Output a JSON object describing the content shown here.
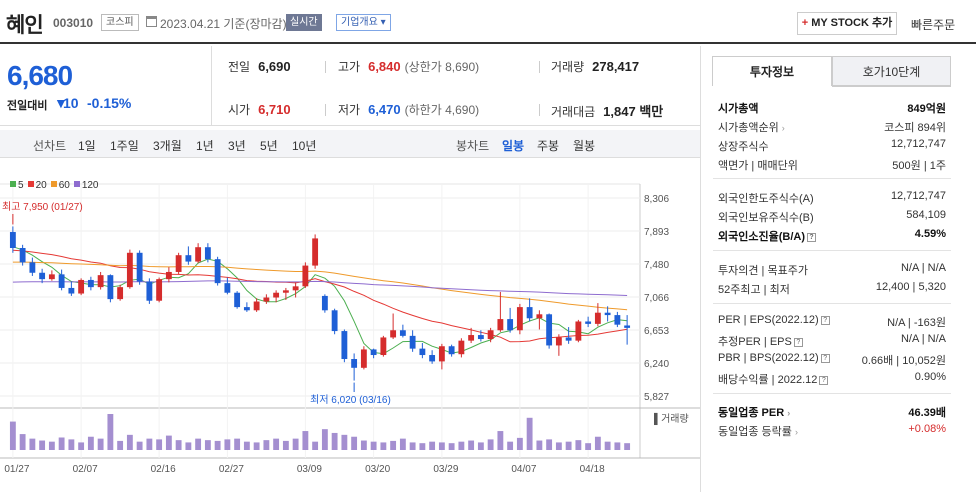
{
  "header": {
    "stock_name": "혜인",
    "stock_code": "003010",
    "market": "코스피",
    "date": "2023.04.21 기준(장마감)",
    "live_label": "실시간",
    "overview_label": "기업개요 ▾",
    "mystock_plus": "+",
    "mystock_label": "MY STOCK 추가",
    "quick_order": "빠른주문"
  },
  "quote": {
    "price": "6,680",
    "change_label": "전일대비",
    "change_arrow": "▼",
    "change_amount": "10",
    "change_pct": "-0.15%",
    "prev_close_label": "전일",
    "prev_close": "6,690",
    "high_label": "고가",
    "high": "6,840",
    "upper_limit": "(상한가 8,690)",
    "volume_label": "거래량",
    "volume": "278,417",
    "open_label": "시가",
    "open": "6,710",
    "low_label": "저가",
    "low": "6,470",
    "lower_limit": "(하한가 4,690)",
    "amount_label": "거래대금",
    "amount": "1,847 백만"
  },
  "tabs": {
    "line_chart": "선차트",
    "d1": "1일",
    "w1": "1주일",
    "m3": "3개월",
    "y1": "1년",
    "y3": "3년",
    "y5": "5년",
    "y10": "10년",
    "candle": "봉차트",
    "daily": "일봉",
    "weekly": "주봉",
    "monthly": "월봉"
  },
  "chart_data": {
    "type": "candlestick",
    "legend": [
      {
        "name": "5",
        "color": "#4caf50"
      },
      {
        "name": "20",
        "color": "#e53935"
      },
      {
        "name": "60",
        "color": "#ef9a2b"
      },
      {
        "name": "120",
        "color": "#8e6ccf"
      }
    ],
    "y_ticks": [
      "8,306",
      "7,893",
      "7,480",
      "7,066",
      "6,653",
      "6,240",
      "5,827"
    ],
    "ylim": [
      5827,
      8306
    ],
    "x_ticks": [
      "01/27",
      "02/07",
      "02/16",
      "02/27",
      "03/09",
      "03/20",
      "03/29",
      "04/07",
      "04/18"
    ],
    "max_label": "최고 7,950 (01/27)",
    "min_label": "최저 6,020 (03/16)",
    "volume_label": "거래량",
    "candles": [
      [
        7880,
        7950,
        7620,
        7680
      ],
      [
        7680,
        7720,
        7460,
        7500
      ],
      [
        7500,
        7560,
        7330,
        7370
      ],
      [
        7370,
        7420,
        7240,
        7290
      ],
      [
        7290,
        7400,
        7270,
        7350
      ],
      [
        7350,
        7410,
        7150,
        7180
      ],
      [
        7180,
        7260,
        7080,
        7110
      ],
      [
        7110,
        7300,
        7090,
        7280
      ],
      [
        7280,
        7320,
        7150,
        7190
      ],
      [
        7190,
        7380,
        7160,
        7340
      ],
      [
        7340,
        7350,
        7000,
        7040
      ],
      [
        7040,
        7220,
        7020,
        7190
      ],
      [
        7190,
        7660,
        7170,
        7620
      ],
      [
        7620,
        7650,
        7220,
        7260
      ],
      [
        7260,
        7300,
        6980,
        7020
      ],
      [
        7020,
        7310,
        7000,
        7290
      ],
      [
        7290,
        7440,
        7250,
        7380
      ],
      [
        7380,
        7620,
        7350,
        7590
      ],
      [
        7590,
        7700,
        7470,
        7510
      ],
      [
        7510,
        7740,
        7490,
        7690
      ],
      [
        7690,
        7740,
        7500,
        7540
      ],
      [
        7540,
        7570,
        7210,
        7240
      ],
      [
        7240,
        7310,
        7100,
        7120
      ],
      [
        7120,
        7140,
        6920,
        6940
      ],
      [
        6940,
        7000,
        6880,
        6900
      ],
      [
        6900,
        7050,
        6880,
        7010
      ],
      [
        7010,
        7100,
        6980,
        7060
      ],
      [
        7060,
        7150,
        7000,
        7120
      ],
      [
        7120,
        7180,
        7030,
        7150
      ],
      [
        7150,
        7250,
        7060,
        7200
      ],
      [
        7200,
        7500,
        7180,
        7460
      ],
      [
        7460,
        7850,
        7420,
        7800
      ],
      [
        7080,
        7100,
        6870,
        6900
      ],
      [
        6900,
        6920,
        6600,
        6640
      ],
      [
        6640,
        6660,
        6250,
        6290
      ],
      [
        6290,
        6360,
        6020,
        6180
      ],
      [
        6180,
        6450,
        6160,
        6410
      ],
      [
        6410,
        6420,
        6300,
        6340
      ],
      [
        6340,
        6580,
        6320,
        6560
      ],
      [
        6560,
        6860,
        6540,
        6650
      ],
      [
        6650,
        6720,
        6560,
        6580
      ],
      [
        6580,
        6650,
        6380,
        6420
      ],
      [
        6420,
        6490,
        6300,
        6340
      ],
      [
        6340,
        6400,
        6230,
        6260
      ],
      [
        6260,
        6480,
        6160,
        6450
      ],
      [
        6450,
        6470,
        6320,
        6350
      ],
      [
        6350,
        6550,
        6310,
        6520
      ],
      [
        6520,
        6680,
        6490,
        6590
      ],
      [
        6590,
        6650,
        6510,
        6540
      ],
      [
        6540,
        6680,
        6500,
        6650
      ],
      [
        6650,
        7130,
        6630,
        6790
      ],
      [
        6790,
        6930,
        6620,
        6650
      ],
      [
        6650,
        6980,
        6600,
        6940
      ],
      [
        6940,
        7050,
        6760,
        6800
      ],
      [
        6800,
        6900,
        6660,
        6850
      ],
      [
        6850,
        6860,
        6420,
        6460
      ],
      [
        6460,
        6600,
        6330,
        6560
      ],
      [
        6560,
        6690,
        6480,
        6520
      ],
      [
        6520,
        6780,
        6500,
        6760
      ],
      [
        6760,
        6820,
        6690,
        6730
      ],
      [
        6730,
        6990,
        6700,
        6870
      ],
      [
        6870,
        6950,
        6760,
        6840
      ],
      [
        6840,
        6880,
        6690,
        6720
      ],
      [
        6710,
        6840,
        6470,
        6680
      ]
    ],
    "volumes": [
      75,
      42,
      30,
      25,
      22,
      33,
      28,
      20,
      35,
      30,
      95,
      24,
      40,
      22,
      30,
      28,
      38,
      26,
      20,
      30,
      26,
      24,
      28,
      30,
      22,
      20,
      26,
      30,
      24,
      30,
      50,
      22,
      55,
      45,
      40,
      35,
      25,
      22,
      20,
      24,
      30,
      20,
      18,
      22,
      20,
      18,
      22,
      25,
      20,
      28,
      50,
      22,
      32,
      85,
      25,
      28,
      20,
      22,
      26,
      18,
      35,
      22,
      20,
      18
    ]
  },
  "info": {
    "tab_active": "투자정보",
    "tab_other": "호가10단계",
    "market_cap_label": "시가총액",
    "market_cap": "849억원",
    "market_cap_rank_label": "시가총액순위",
    "market_cap_rank": "코스피 894위",
    "shares_label": "상장주식수",
    "shares": "12,712,747",
    "par_label": "액면가",
    "trade_unit_label": "매매단위",
    "par_value": "500원",
    "trade_unit": "1주",
    "foreign_limit_label": "외국인한도주식수(A)",
    "foreign_limit": "12,712,747",
    "foreign_hold_label": "외국인보유주식수(B)",
    "foreign_hold": "584,109",
    "foreign_rate_label": "외국인소진율(B/A)",
    "foreign_rate": "4.59%",
    "opinion_label": "투자의견",
    "target_label": "목표주가",
    "opinion": "N/A",
    "target": "N/A",
    "w52_high_label": "52주최고",
    "w52_low_label": "최저",
    "w52_high": "12,400",
    "w52_low": "5,320",
    "per_label": "PER",
    "eps_label": "EPS(2022.12)",
    "per": "N/A",
    "eps": "-163원",
    "est_per_label": "추정PER",
    "est_eps_label": "EPS",
    "est_per": "N/A",
    "est_eps": "N/A",
    "pbr_label": "PBR",
    "bps_label": "BPS(2022.12)",
    "pbr": "0.66배",
    "bps": "10,052원",
    "div_label": "배당수익률",
    "div_date": "2022.12",
    "div": "0.90%",
    "ind_per_label": "동일업종 PER",
    "ind_per": "46.39배",
    "ind_chg_label": "동일업종 등락률",
    "ind_chg": "+0.08%"
  },
  "colors": {
    "up": "#d52c2c",
    "down": "#1e5fd6"
  }
}
